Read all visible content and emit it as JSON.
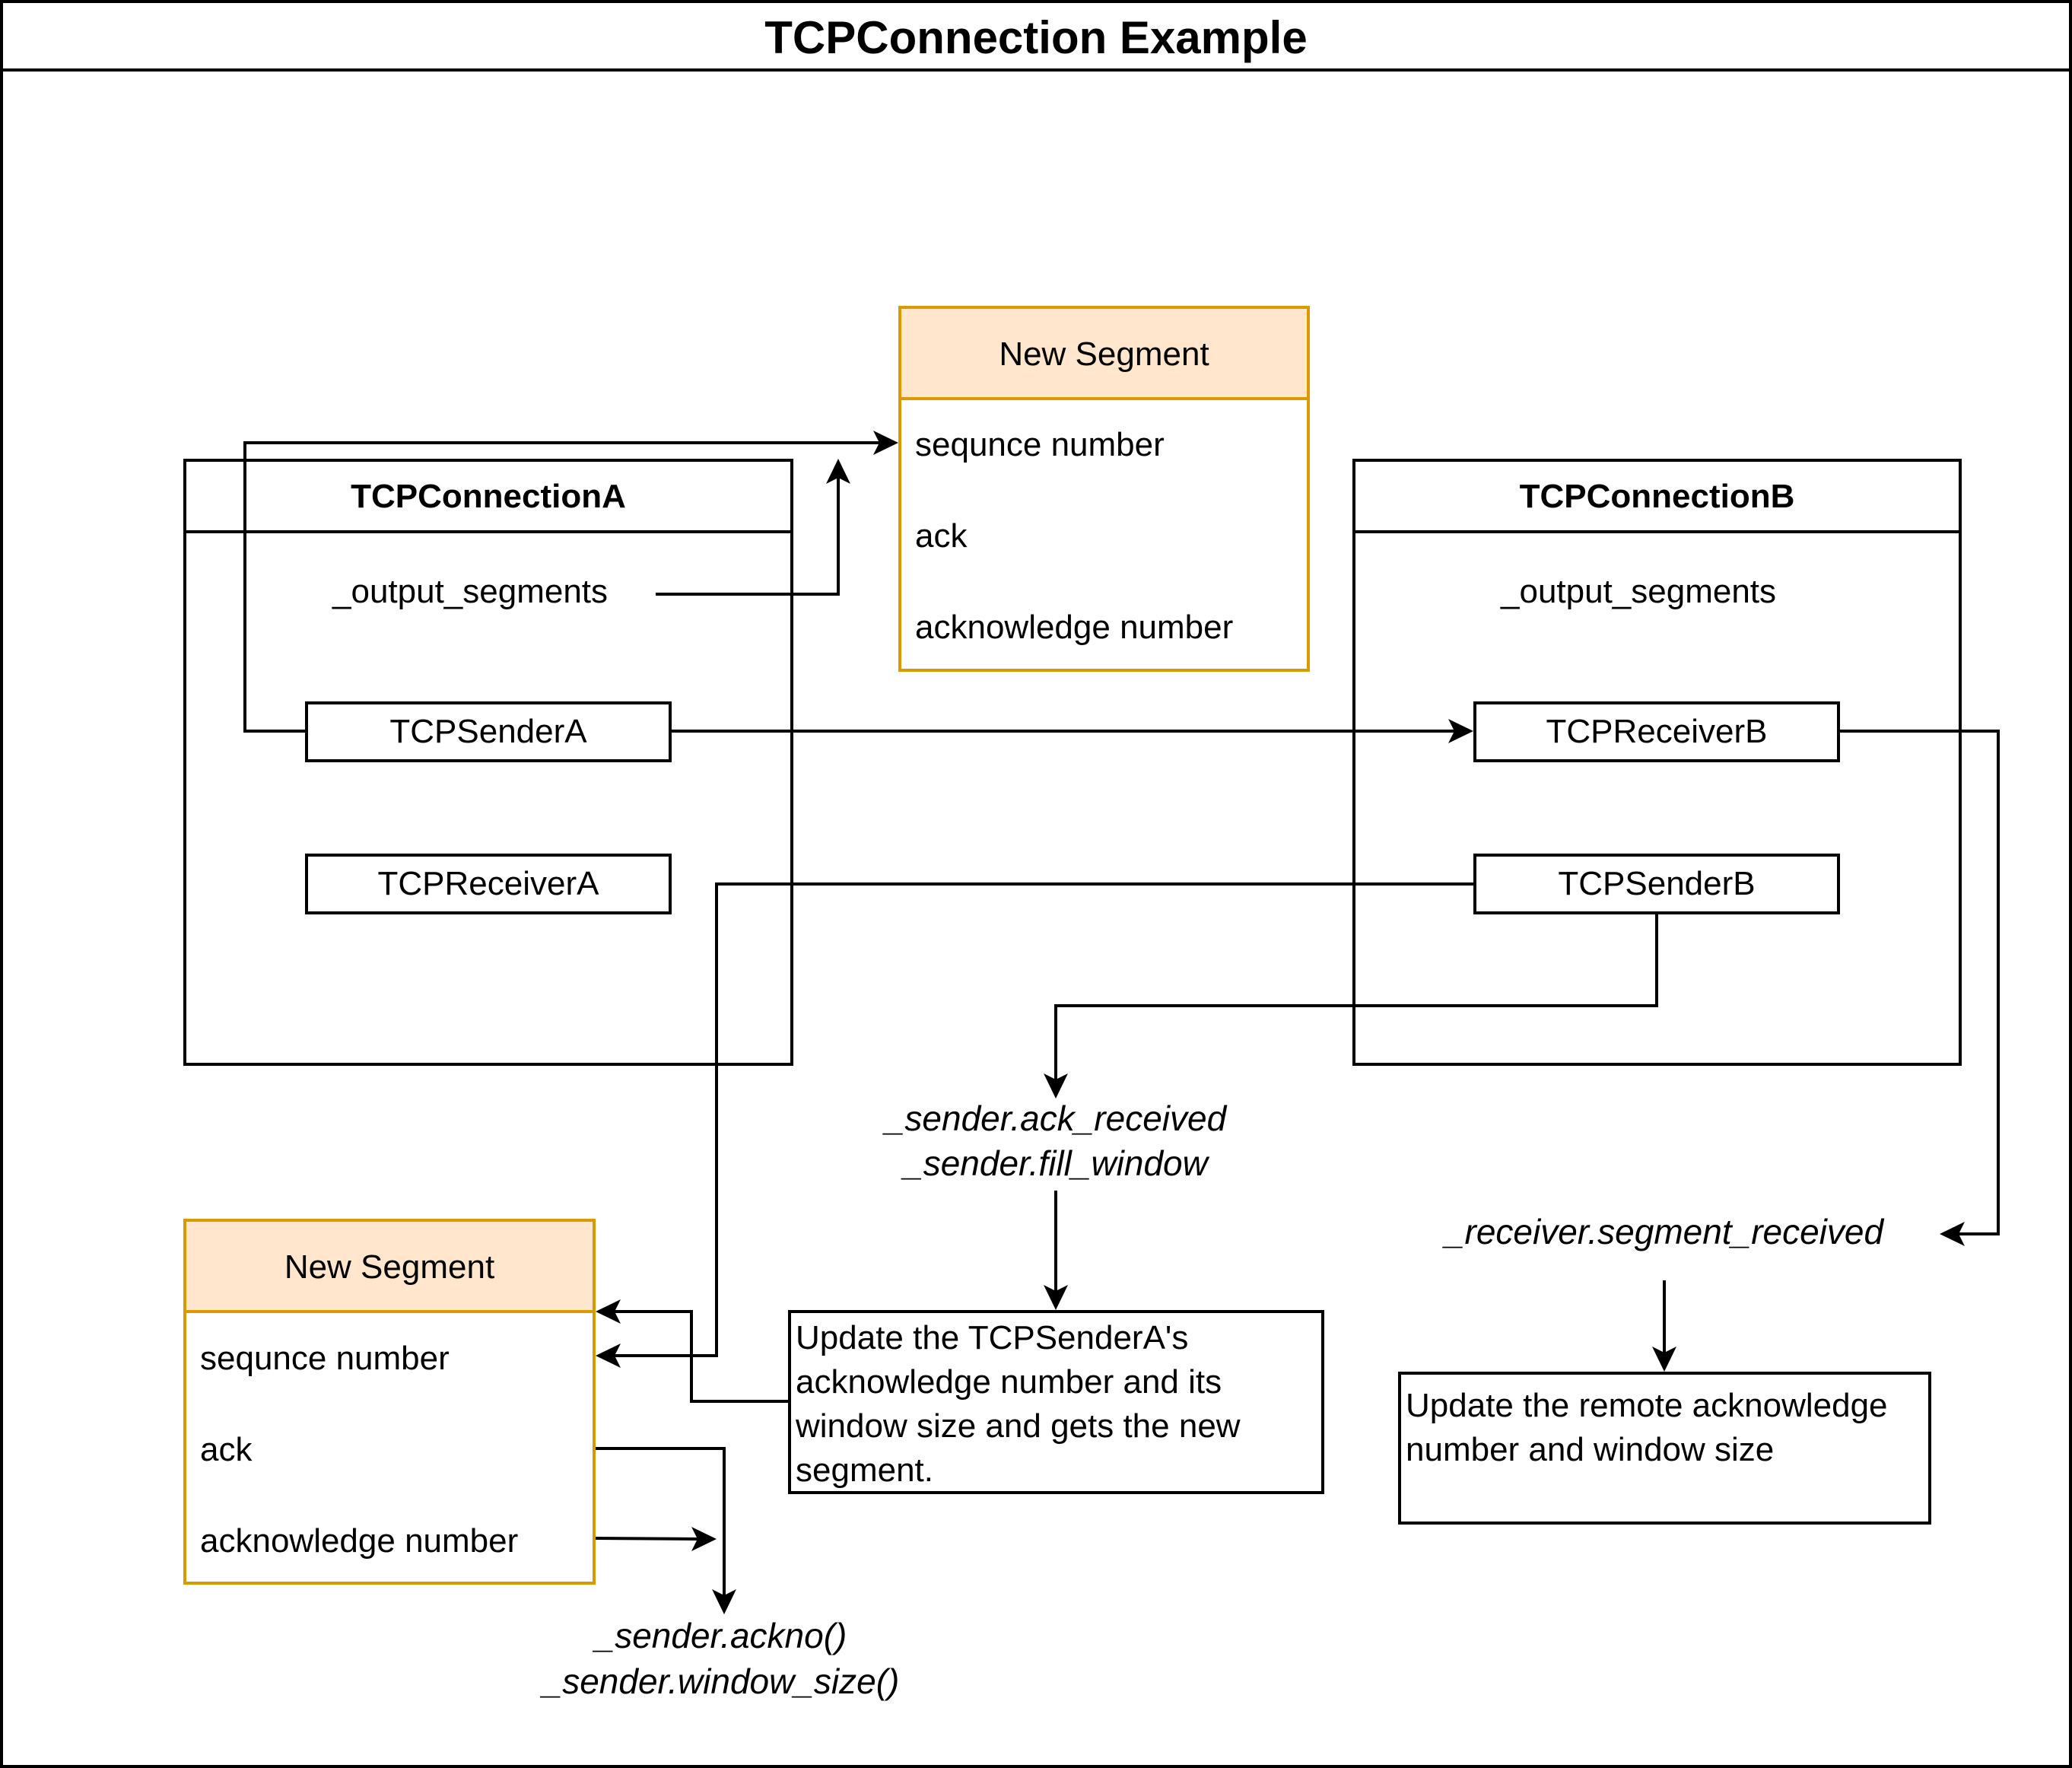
{
  "title": "TCPConnection Example",
  "top_segment": {
    "header": "New Segment",
    "fields": [
      "sequnce number",
      "ack",
      "acknowledge number"
    ]
  },
  "connection_a": {
    "title": "TCPConnectionA",
    "output_label": "_output_segments",
    "sender": "TCPSenderA",
    "receiver": "TCPReceiverA"
  },
  "connection_b": {
    "title": "TCPConnectionB",
    "output_label": "_output_segments",
    "receiver": "TCPReceiverB",
    "sender": "TCPSenderB"
  },
  "sender_calls": {
    "line1": "_sender.ack_received",
    "line2": "_sender.fill_window"
  },
  "receiver_call": "_receiver.segment_received",
  "update_sender_note": "Update the TCPSenderA's acknowledge number and its window size and gets the new segment.",
  "update_remote_note": "Update the remote acknowledge number and window size",
  "bottom_segment": {
    "header": "New Segment",
    "fields": [
      "sequnce number",
      "ack",
      "acknowledge number"
    ]
  },
  "ackno_calls": {
    "line1": "_sender.ackno()",
    "line2": "_sender.window_size()"
  },
  "colors": {
    "segment_border": "#d79b00",
    "segment_header_fill": "#ffe6cc",
    "line": "#000000"
  }
}
